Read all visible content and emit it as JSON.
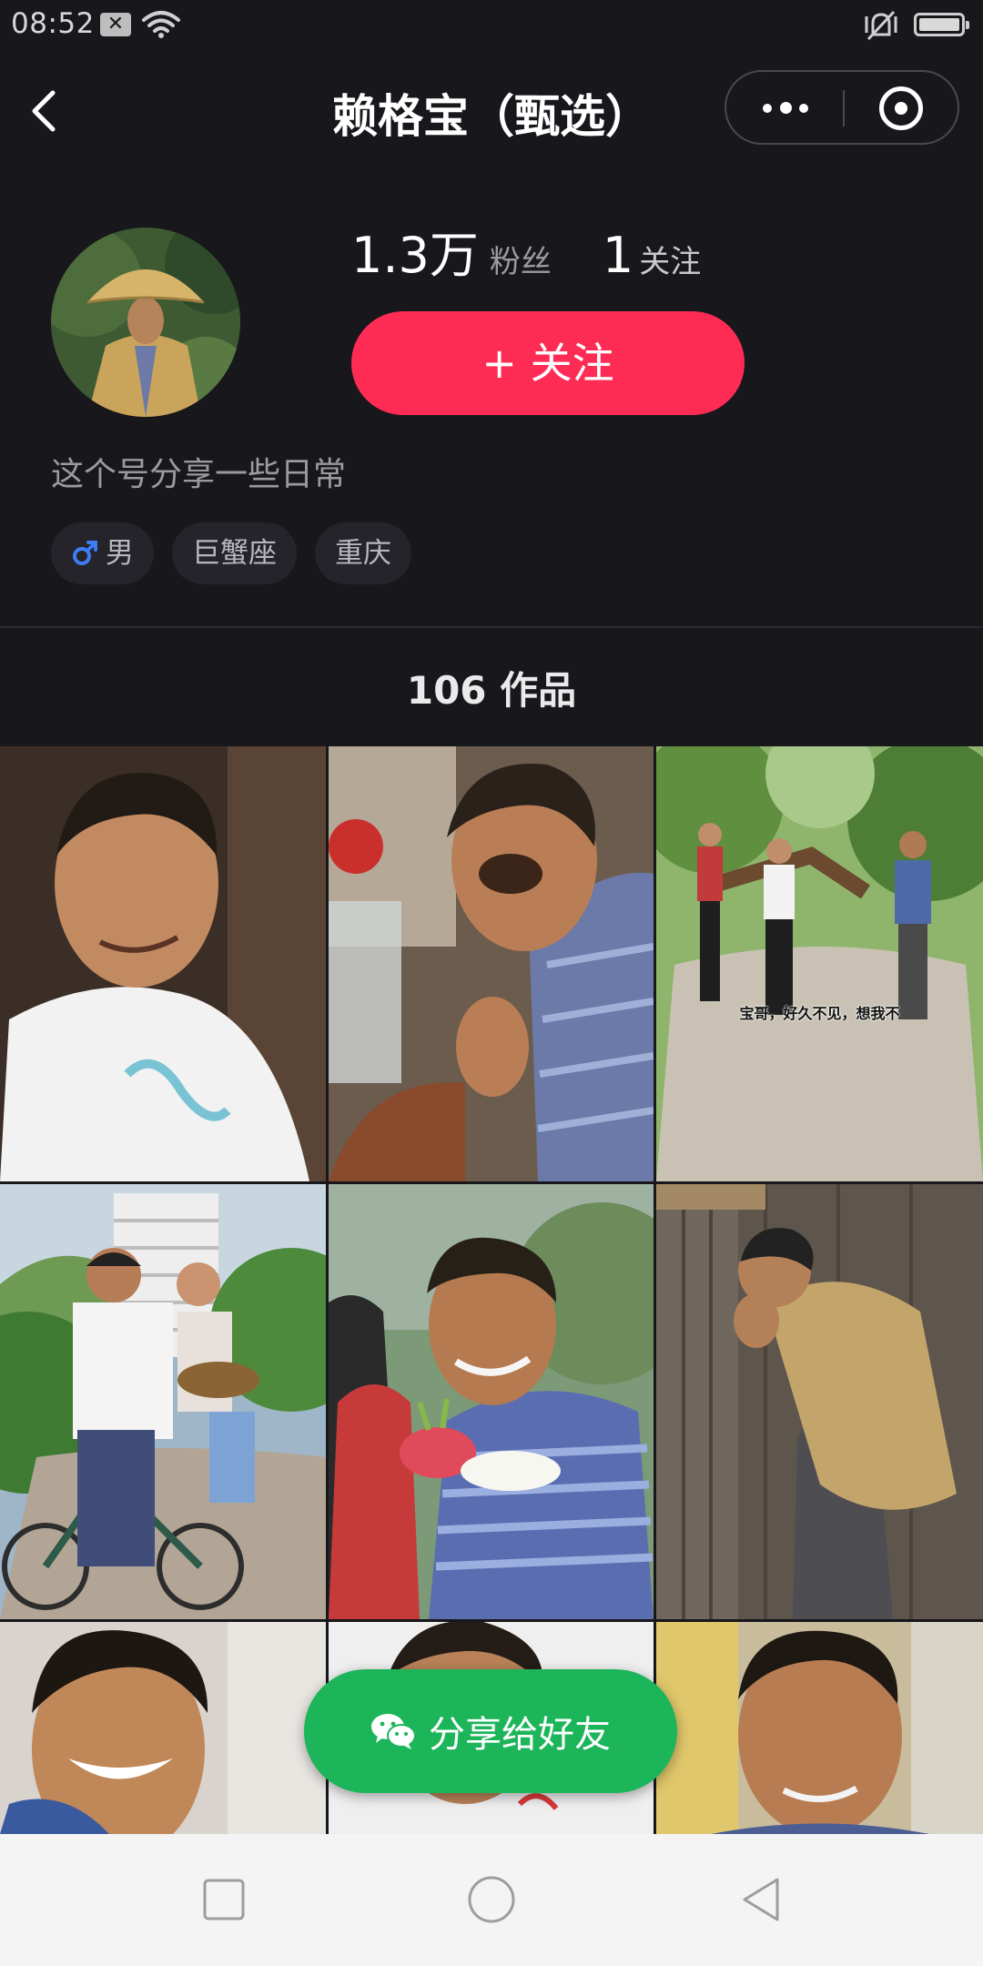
{
  "status_bar": {
    "time": "08:52",
    "notification_glyph": "✕",
    "icons": [
      "notification-x-icon",
      "wifi-icon",
      "mute-vibrate-icon",
      "battery-icon"
    ]
  },
  "header": {
    "title": "赖格宝（甄选）",
    "back_icon": "chevron-left-icon",
    "more_icon": "more-dots-icon",
    "close_icon": "target-close-icon"
  },
  "profile": {
    "fans_count": "1.3万",
    "fans_label": "粉丝",
    "following_count": "1",
    "following_label": "关注",
    "follow_button_label": "+ 关注",
    "bio": "这个号分享一些日常",
    "tags": [
      {
        "label": "男",
        "icon": "male-icon"
      },
      {
        "label": "巨蟹座"
      },
      {
        "label": "重庆"
      }
    ]
  },
  "works": {
    "count_label": "106 作品",
    "items": [
      {
        "caption": ""
      },
      {
        "caption": ""
      },
      {
        "caption": "宝哥，好久不见，想我不"
      },
      {
        "caption": ""
      },
      {
        "caption": ""
      },
      {
        "caption": ""
      },
      {
        "caption": ""
      },
      {
        "caption": ""
      },
      {
        "caption": ""
      }
    ]
  },
  "share": {
    "label": "分享给好友",
    "icon": "wechat-icon"
  },
  "nav_bar": {
    "icons": [
      "recent-apps-square-icon",
      "home-circle-icon",
      "back-triangle-icon"
    ]
  },
  "colors": {
    "background": "#18171c",
    "follow_button": "#fe2c55",
    "share_button": "#1db55a",
    "tag_background": "#25242a"
  }
}
